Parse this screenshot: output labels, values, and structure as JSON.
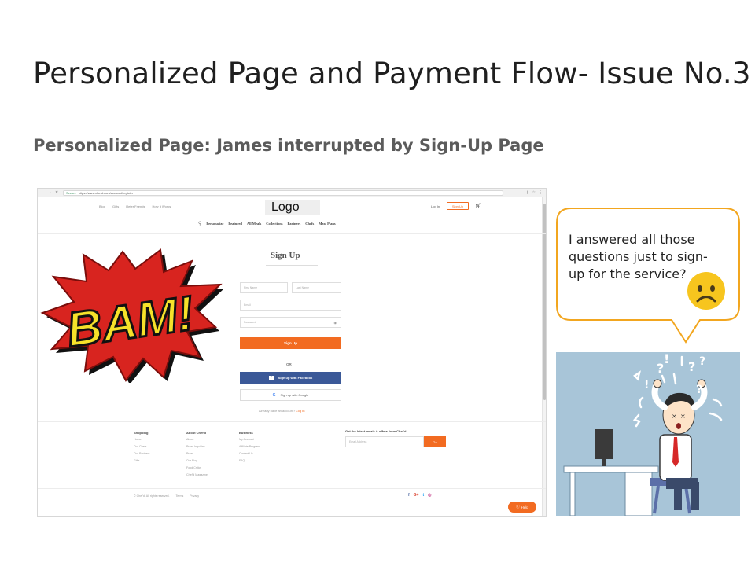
{
  "slide": {
    "title": "Personalized Page and Payment Flow- Issue No.3",
    "subtitle": "Personalized Page: James interrupted by Sign-Up Page"
  },
  "browser": {
    "nav_buttons": [
      "←",
      "→",
      "✕"
    ],
    "secure_label": "Secure",
    "url": "https://www.chefd.com/account/register",
    "top_links": [
      "Blog",
      "Gifts",
      "Refer Friends",
      "How It Works"
    ],
    "logo_text": "Logo",
    "login_label": "Log In",
    "signup_label": "Sign Up",
    "nav_items": [
      "Personalize",
      "Featured",
      "All Meals",
      "Collections",
      "Partners",
      "Chefs",
      "Meal Plans"
    ],
    "form": {
      "title": "Sign Up",
      "first_name_placeholder": "First Name",
      "last_name_placeholder": "Last Name",
      "email_placeholder": "Email",
      "password_placeholder": "Password",
      "submit_label": "Sign Up",
      "or_label": "OR",
      "facebook_label": "Sign up with Facebook",
      "google_label": "Sign up with Google",
      "already_text": "Already have an account?",
      "login_link": "Log In"
    },
    "footer": {
      "shopping": {
        "heading": "Shopping",
        "items": [
          "Home",
          "Our Chefs",
          "Our Partners",
          "Gifts"
        ]
      },
      "about": {
        "heading": "About Chef'd",
        "items": [
          "About",
          "Press Inquiries",
          "Press",
          "Our Blog",
          "Food Critics",
          "Chef'd Magazine"
        ]
      },
      "business": {
        "heading": "Business",
        "items": [
          "My Account",
          "Affiliate Program",
          "Contact Us",
          "FAQ"
        ]
      },
      "newsletter_heading": "Get the latest meals & offers from Chef'd",
      "email_placeholder": "Email Address",
      "go_label": "Go",
      "copyright": "© Chef'd. All rights reserved.",
      "terms": "Terms",
      "privacy": "Privacy",
      "help_label": "Help"
    }
  },
  "bam_text": "BAM!",
  "bubble": {
    "text": "I answered all those questions just to sign-up for the service?"
  },
  "colors": {
    "accent": "#f26b21",
    "facebook": "#3b5998",
    "bubble_border": "#f2a61f",
    "emoji": "#f7c51e"
  }
}
